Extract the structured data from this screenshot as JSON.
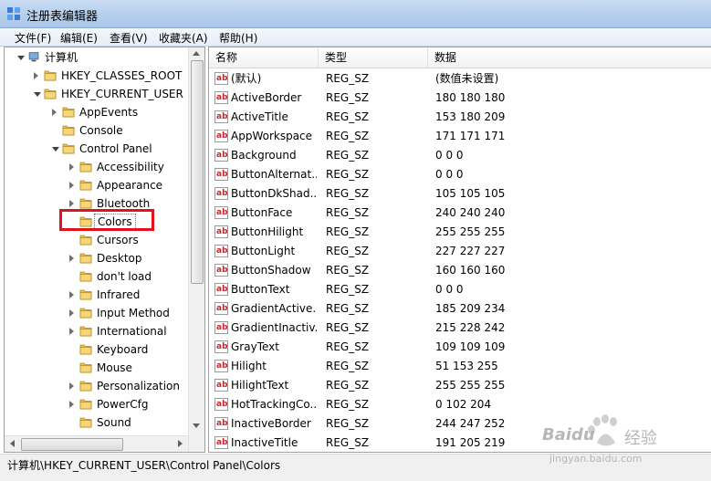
{
  "window": {
    "title": "注册表编辑器"
  },
  "menu": [
    "文件(F)",
    "编辑(E)",
    "查看(V)",
    "收藏夹(A)",
    "帮助(H)"
  ],
  "tree": [
    {
      "label": "计算机",
      "depth": 0,
      "expander": "open",
      "icon": "computer-icon"
    },
    {
      "label": "HKEY_CLASSES_ROOT",
      "depth": 1,
      "expander": "closed"
    },
    {
      "label": "HKEY_CURRENT_USER",
      "depth": 1,
      "expander": "open"
    },
    {
      "label": "AppEvents",
      "depth": 2,
      "expander": "closed"
    },
    {
      "label": "Console",
      "depth": 2,
      "expander": "none"
    },
    {
      "label": "Control Panel",
      "depth": 2,
      "expander": "open"
    },
    {
      "label": "Accessibility",
      "depth": 3,
      "expander": "closed"
    },
    {
      "label": "Appearance",
      "depth": 3,
      "expander": "closed"
    },
    {
      "label": "Bluetooth",
      "depth": 3,
      "expander": "closed"
    },
    {
      "label": "Colors",
      "depth": 3,
      "expander": "none",
      "selected": true
    },
    {
      "label": "Cursors",
      "depth": 3,
      "expander": "none"
    },
    {
      "label": "Desktop",
      "depth": 3,
      "expander": "closed"
    },
    {
      "label": "don't load",
      "depth": 3,
      "expander": "none"
    },
    {
      "label": "Infrared",
      "depth": 3,
      "expander": "closed"
    },
    {
      "label": "Input Method",
      "depth": 3,
      "expander": "closed"
    },
    {
      "label": "International",
      "depth": 3,
      "expander": "closed"
    },
    {
      "label": "Keyboard",
      "depth": 3,
      "expander": "none"
    },
    {
      "label": "Mouse",
      "depth": 3,
      "expander": "none"
    },
    {
      "label": "Personalization",
      "depth": 3,
      "expander": "closed"
    },
    {
      "label": "PowerCfg",
      "depth": 3,
      "expander": "closed"
    },
    {
      "label": "Sound",
      "depth": 3,
      "expander": "none"
    }
  ],
  "columns": [
    "名称",
    "类型",
    "数据"
  ],
  "values": [
    {
      "name": "(默认)",
      "type": "REG_SZ",
      "data": "(数值未设置)"
    },
    {
      "name": "ActiveBorder",
      "type": "REG_SZ",
      "data": "180 180 180"
    },
    {
      "name": "ActiveTitle",
      "type": "REG_SZ",
      "data": "153 180 209"
    },
    {
      "name": "AppWorkspace",
      "type": "REG_SZ",
      "data": "171 171 171"
    },
    {
      "name": "Background",
      "type": "REG_SZ",
      "data": "0 0 0"
    },
    {
      "name": "ButtonAlternat...",
      "type": "REG_SZ",
      "data": "0 0 0"
    },
    {
      "name": "ButtonDkShad...",
      "type": "REG_SZ",
      "data": "105 105 105"
    },
    {
      "name": "ButtonFace",
      "type": "REG_SZ",
      "data": "240 240 240"
    },
    {
      "name": "ButtonHilight",
      "type": "REG_SZ",
      "data": "255 255 255"
    },
    {
      "name": "ButtonLight",
      "type": "REG_SZ",
      "data": "227 227 227"
    },
    {
      "name": "ButtonShadow",
      "type": "REG_SZ",
      "data": "160 160 160"
    },
    {
      "name": "ButtonText",
      "type": "REG_SZ",
      "data": "0 0 0"
    },
    {
      "name": "GradientActive...",
      "type": "REG_SZ",
      "data": "185 209 234"
    },
    {
      "name": "GradientInactiv...",
      "type": "REG_SZ",
      "data": "215 228 242"
    },
    {
      "name": "GrayText",
      "type": "REG_SZ",
      "data": "109 109 109"
    },
    {
      "name": "Hilight",
      "type": "REG_SZ",
      "data": "51 153 255"
    },
    {
      "name": "HilightText",
      "type": "REG_SZ",
      "data": "255 255 255"
    },
    {
      "name": "HotTrackingCo...",
      "type": "REG_SZ",
      "data": "0 102 204"
    },
    {
      "name": "InactiveBorder",
      "type": "REG_SZ",
      "data": "244 247 252"
    },
    {
      "name": "InactiveTitle",
      "type": "REG_SZ",
      "data": "191 205 219"
    }
  ],
  "status": {
    "path": "计算机\\HKEY_CURRENT_USER\\Control Panel\\Colors"
  },
  "watermark": {
    "brand": "Baidu",
    "brand_cn": "经验",
    "url": "jingyan.baidu.com"
  },
  "colors": {
    "highlight_box": "#e0121d",
    "value_icon_text": "#c0282d"
  }
}
